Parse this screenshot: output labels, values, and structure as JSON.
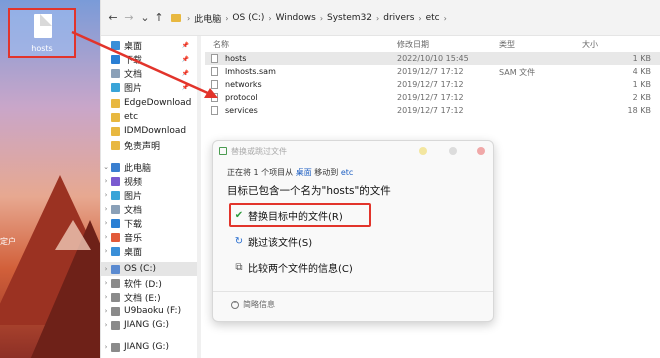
{
  "desktop": {
    "file_label": "hosts",
    "side_text": "定户"
  },
  "address": {
    "back": "←",
    "forward": "→",
    "down": "⌄",
    "up": "↑",
    "path": [
      "此电脑",
      "OS (C:)",
      "Windows",
      "System32",
      "drivers",
      "etc"
    ]
  },
  "sidebar": {
    "items": [
      {
        "label": "桌面",
        "icon": "desktop-icon",
        "color": "#3a8fd8",
        "pinned": true
      },
      {
        "label": "下载",
        "icon": "download-icon",
        "color": "#2a7fd4",
        "pinned": true
      },
      {
        "label": "文档",
        "icon": "documents-icon",
        "color": "#8aa0b8",
        "pinned": true
      },
      {
        "label": "图片",
        "icon": "pictures-icon",
        "color": "#3aa4d8",
        "pinned": true
      },
      {
        "label": "EdgeDownload",
        "icon": "folder-icon",
        "color": "#e8b840"
      },
      {
        "label": "etc",
        "icon": "folder-icon",
        "color": "#e8b840"
      },
      {
        "label": "IDMDownload",
        "icon": "folder-icon",
        "color": "#e8b840"
      },
      {
        "label": "免责声明",
        "icon": "folder-icon",
        "color": "#e8b840"
      },
      {
        "label": "此电脑",
        "icon": "this-pc-icon",
        "color": "#3a7fd0",
        "chevron": "⌄"
      },
      {
        "label": "视频",
        "icon": "videos-icon",
        "color": "#7a5ad0",
        "chevron": "›"
      },
      {
        "label": "图片",
        "icon": "pictures-icon",
        "color": "#3aa4d8",
        "chevron": "›"
      },
      {
        "label": "文档",
        "icon": "documents-icon",
        "color": "#8aa0b8",
        "chevron": "›"
      },
      {
        "label": "下载",
        "icon": "download-icon",
        "color": "#2a7fd4",
        "chevron": "›"
      },
      {
        "label": "音乐",
        "icon": "music-icon",
        "color": "#e25a3a",
        "chevron": "›"
      },
      {
        "label": "桌面",
        "icon": "desktop-icon",
        "color": "#3a8fd8",
        "chevron": "›"
      },
      {
        "label": "OS (C:)",
        "icon": "drive-icon",
        "color": "#5a8ad0",
        "chevron": "›",
        "selected": true
      },
      {
        "label": "软件 (D:)",
        "icon": "drive-icon",
        "color": "#8a8a8a",
        "chevron": "›"
      },
      {
        "label": "文档 (E:)",
        "icon": "drive-icon",
        "color": "#8a8a8a",
        "chevron": "›"
      },
      {
        "label": "U9baoku (F:)",
        "icon": "drive-icon",
        "color": "#8a8a8a",
        "chevron": "›"
      },
      {
        "label": "JIANG (G:)",
        "icon": "drive-icon",
        "color": "#8a8a8a",
        "chevron": "›"
      },
      {
        "label": "JIANG (G:)",
        "icon": "usb-drive-icon",
        "color": "#8a8a8a",
        "chevron": "›"
      }
    ]
  },
  "filelist": {
    "headers": {
      "name": "名称",
      "date": "修改日期",
      "type": "类型",
      "size": "大小"
    },
    "rows": [
      {
        "name": "hosts",
        "date": "2022/10/10 15:45",
        "type": "",
        "size": "1 KB",
        "highlighted": true
      },
      {
        "name": "lmhosts.sam",
        "date": "2019/12/7 17:12",
        "type": "SAM 文件",
        "size": "4 KB"
      },
      {
        "name": "networks",
        "date": "2019/12/7 17:12",
        "type": "",
        "size": "1 KB"
      },
      {
        "name": "protocol",
        "date": "2019/12/7 17:12",
        "type": "",
        "size": "2 KB"
      },
      {
        "name": "services",
        "date": "2019/12/7 17:12",
        "type": "",
        "size": "18 KB"
      }
    ]
  },
  "dialog": {
    "title": "替换或跳过文件",
    "subtitle_pre": "正在将 1 个项目从",
    "subtitle_src": "桌面",
    "subtitle_mid": "移动到",
    "subtitle_dst": "etc",
    "heading": "目标已包含一个名为\"hosts\"的文件",
    "options": [
      {
        "label": "替换目标中的文件(R)",
        "icon": "checkmark-icon",
        "icon_char": "✔",
        "icon_color": "#2e9b3e"
      },
      {
        "label": "跳过该文件(S)",
        "icon": "skip-icon",
        "icon_char": "↻",
        "icon_color": "#2a6fd0"
      },
      {
        "label": "比较两个文件的信息(C)",
        "icon": "compare-icon",
        "icon_char": "⧉",
        "icon_color": "#555"
      }
    ],
    "footer": "简略信息",
    "colors": {
      "highlight_box": "#e2342b",
      "link": "#1e5fc2"
    }
  }
}
